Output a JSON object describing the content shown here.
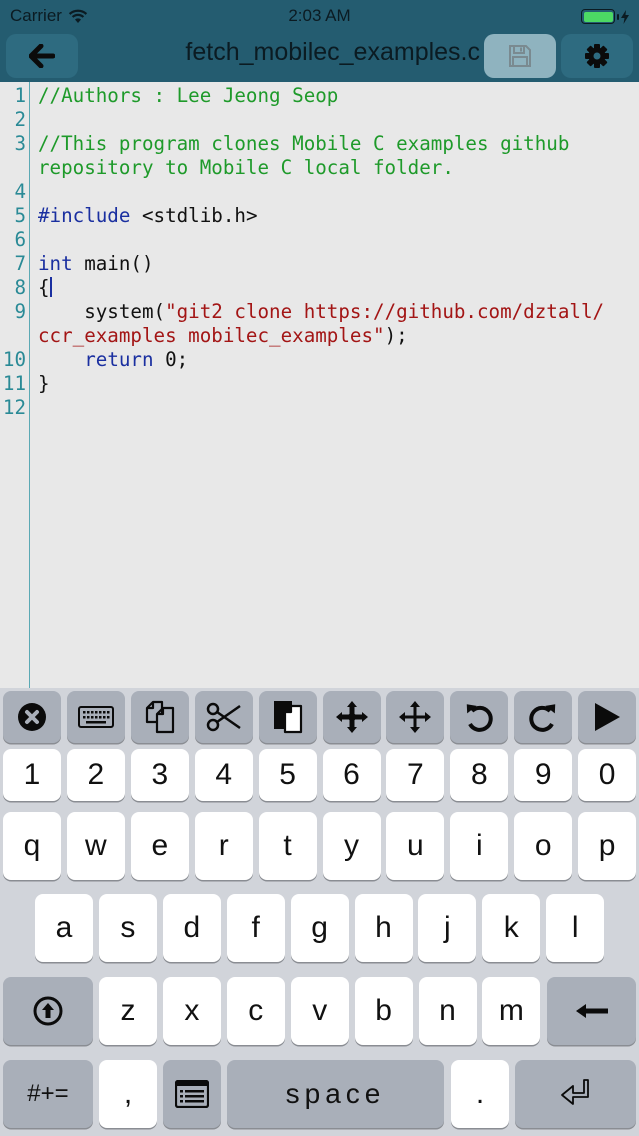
{
  "status_bar": {
    "carrier": "Carrier",
    "time": "2:03 AM",
    "wifi_icon": "wifi-icon",
    "battery_icon": "battery-charging-icon",
    "battery_level": 1.0
  },
  "nav_bar": {
    "back_icon": "arrow-left-icon",
    "title": "fetch_mobilec_examples.c",
    "save_icon": "floppy-disk-icon",
    "save_enabled": false,
    "settings_icon": "gear-icon"
  },
  "editor": {
    "lines": [
      {
        "n": "1",
        "segments": [
          {
            "t": "//Authors : Lee Jeong Seop",
            "c": "comment"
          }
        ]
      },
      {
        "n": "2",
        "segments": []
      },
      {
        "n": "3",
        "segments": [
          {
            "t": "//This program clones Mobile C examples github",
            "c": "comment"
          }
        ]
      },
      {
        "n": "",
        "segments": [
          {
            "t": "repository to Mobile C local folder.",
            "c": "comment"
          }
        ]
      },
      {
        "n": "4",
        "segments": []
      },
      {
        "n": "5",
        "segments": [
          {
            "t": "#include",
            "c": "kw"
          },
          {
            "t": " <stdlib.h>",
            "c": "plain"
          }
        ]
      },
      {
        "n": "6",
        "segments": []
      },
      {
        "n": "7",
        "segments": [
          {
            "t": "int",
            "c": "kw"
          },
          {
            "t": " main()",
            "c": "plain"
          }
        ]
      },
      {
        "n": "8",
        "segments": [
          {
            "t": "{",
            "c": "plain"
          }
        ],
        "caret": true
      },
      {
        "n": "9",
        "segments": [
          {
            "t": "    system(",
            "c": "plain"
          },
          {
            "t": "\"git2 clone https://github.com/dztall/",
            "c": "str"
          }
        ]
      },
      {
        "n": "",
        "segments": [
          {
            "t": "ccr_examples mobilec_examples\"",
            "c": "str"
          },
          {
            "t": ");",
            "c": "plain"
          }
        ]
      },
      {
        "n": "10",
        "segments": [
          {
            "t": "    ",
            "c": "plain"
          },
          {
            "t": "return",
            "c": "kw"
          },
          {
            "t": " 0;",
            "c": "plain"
          }
        ]
      },
      {
        "n": "11",
        "segments": [
          {
            "t": "}",
            "c": "plain"
          }
        ]
      },
      {
        "n": "12",
        "segments": []
      }
    ]
  },
  "keyboard": {
    "toolbar": [
      {
        "name": "close-keyboard",
        "icon": "close-circle-icon"
      },
      {
        "name": "hide-keyboard",
        "icon": "keyboard-icon"
      },
      {
        "name": "copy",
        "icon": "copy-icon"
      },
      {
        "name": "cut",
        "icon": "scissors-icon"
      },
      {
        "name": "paste",
        "icon": "paste-icon"
      },
      {
        "name": "move-cursor",
        "icon": "arrows-all-icon"
      },
      {
        "name": "select-move",
        "icon": "arrows-cross-icon"
      },
      {
        "name": "undo",
        "icon": "undo-icon"
      },
      {
        "name": "redo",
        "icon": "redo-icon"
      },
      {
        "name": "run",
        "icon": "play-icon"
      }
    ],
    "row_numbers": [
      "1",
      "2",
      "3",
      "4",
      "5",
      "6",
      "7",
      "8",
      "9",
      "0"
    ],
    "row1": [
      "q",
      "w",
      "e",
      "r",
      "t",
      "y",
      "u",
      "i",
      "o",
      "p"
    ],
    "row2": [
      "a",
      "s",
      "d",
      "f",
      "g",
      "h",
      "j",
      "k",
      "l"
    ],
    "row3": [
      "z",
      "x",
      "c",
      "v",
      "b",
      "n",
      "m"
    ],
    "shift_icon": "shift-circle-icon",
    "backspace_icon": "arrow-left-backspace-icon",
    "symbols_label": "#+=",
    "comma_label": ",",
    "list_icon": "list-icon",
    "space_label": "space",
    "period_label": ".",
    "return_icon": "return-icon"
  }
}
